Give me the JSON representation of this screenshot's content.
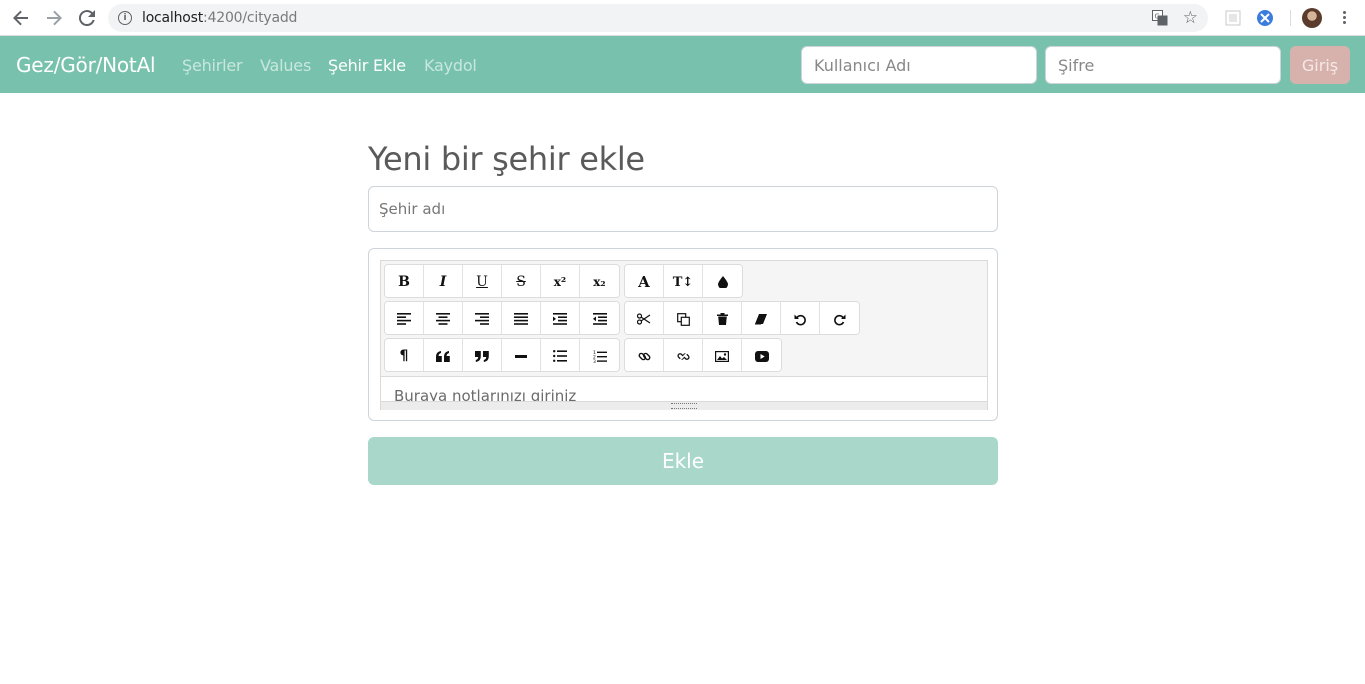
{
  "browser": {
    "url_host": "localhost",
    "url_path": ":4200/cityadd"
  },
  "navbar": {
    "brand": "Gez/Gör/NotAl",
    "links": [
      {
        "label": "Şehirler",
        "active": false
      },
      {
        "label": "Values",
        "active": false
      },
      {
        "label": "Şehir Ekle",
        "active": true
      },
      {
        "label": "Kaydol",
        "active": false
      }
    ],
    "username_placeholder": "Kullanıcı Adı",
    "password_placeholder": "Şifre",
    "login_label": "Giriş",
    "color": "#78c2ad"
  },
  "form": {
    "title": "Yeni bir şehir ekle",
    "city_placeholder": "Şehir adı",
    "editor_placeholder": "Buraya notlarınızı giriniz",
    "submit_label": "Ekle"
  },
  "toolbar": {
    "bold": "B",
    "italic": "I",
    "underline": "U",
    "strike": "S",
    "sup": "x²",
    "sub": "x₂",
    "font": "A",
    "font_size": "T↕",
    "color": "🌢"
  }
}
